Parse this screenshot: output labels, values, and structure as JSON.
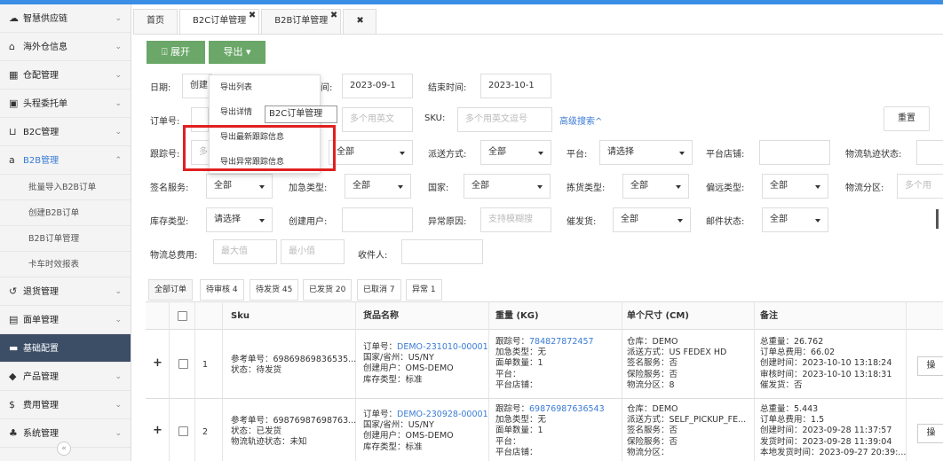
{
  "sidebar": {
    "items": [
      {
        "label": "智慧供应链",
        "icon": "cloud-icon"
      },
      {
        "label": "海外仓信息",
        "icon": "home-icon"
      },
      {
        "label": "仓配管理",
        "icon": "grid-icon"
      },
      {
        "label": "头程委托单",
        "icon": "briefcase-icon"
      },
      {
        "label": "B2C管理",
        "icon": "cart-icon"
      },
      {
        "label": "B2B管理",
        "icon": "amazon-icon"
      }
    ],
    "sub_items": [
      {
        "label": "批量导入B2B订单"
      },
      {
        "label": "创建B2B订单"
      },
      {
        "label": "B2B订单管理"
      },
      {
        "label": "卡车时效报表"
      }
    ],
    "items2": [
      {
        "label": "退货管理",
        "icon": "return-icon"
      },
      {
        "label": "面单管理",
        "icon": "document-icon"
      },
      {
        "label": "基础配置",
        "icon": "folder-icon"
      },
      {
        "label": "产品管理",
        "icon": "tag-icon"
      },
      {
        "label": "费用管理",
        "icon": "dollar-icon"
      },
      {
        "label": "系统管理",
        "icon": "car-icon"
      }
    ]
  },
  "tabs": [
    {
      "label": "首页"
    },
    {
      "label": "B2C订单管理"
    },
    {
      "label": "B2B订单管理"
    }
  ],
  "toolbar": {
    "expand_label": "展开",
    "export_label": "导出"
  },
  "export_menu": [
    {
      "label": "导出列表"
    },
    {
      "label": "导出详情"
    },
    {
      "label": "导出最新跟踪信息"
    },
    {
      "label": "导出异常跟踪信息"
    }
  ],
  "tooltip": "B2C订单管理",
  "filters": {
    "date_label": "日期:",
    "date_type": "创建",
    "date_label2": "间:",
    "start_date": "2023-09-1",
    "end_label": "结束时间:",
    "end_date": "2023-10-1",
    "order_no_label": "订单号:",
    "order_no_placeholder": "多个用英文",
    "sku_label": "SKU:",
    "sku_placeholder": "多个用英文逗号",
    "advanced": "高级搜索^",
    "reset": "重置",
    "tracking_label": "跟踪号:",
    "tracking_prefix": "多",
    "all": "全部",
    "ship_method_label": "派送方式:",
    "platform_label": "平台:",
    "please_select": "请选择",
    "shop_label": "平台店铺:",
    "track_status_label": "物流轨迹状态:",
    "sign_service_label": "签名服务:",
    "urgent_label": "加急类型:",
    "country_label": "国家:",
    "pick_type_label": "拣货类型:",
    "remote_label": "偏远类型:",
    "zone_label": "物流分区:",
    "zone_placeholder": "多个用",
    "stock_type_label": "库存类型:",
    "creator_label": "创建用户:",
    "exception_label": "异常原因:",
    "exception_placeholder": "支持模糊搜",
    "urge_label": "催发货:",
    "mail_status_label": "邮件状态:",
    "fee_label": "物流总费用:",
    "max_placeholder": "最大值",
    "min_placeholder": "最小值",
    "receiver_label": "收件人:"
  },
  "status_tabs": [
    {
      "label": "全部订单"
    },
    {
      "label": "待审核 4"
    },
    {
      "label": "待发货 45"
    },
    {
      "label": "已发货 20"
    },
    {
      "label": "已取消 7"
    },
    {
      "label": "异常 1"
    }
  ],
  "table": {
    "headers": {
      "sku": "Sku",
      "goods": "货品名称",
      "weight": "重量 (KG)",
      "size": "单个尺寸 (CM)",
      "note": "备注"
    },
    "rows": [
      {
        "idx": "1",
        "sku": [
          "参考单号：69869869836535...",
          "状态：待发货"
        ],
        "goods_l": "订单号：",
        "goods_link": "DEMO-231010-00001",
        "goods": [
          "国家/省州：US/NY",
          "创建用户：OMS-DEMO",
          "库存类型：标准"
        ],
        "weight_l": "跟踪号：",
        "weight_link": "784827872457",
        "weight": [
          "加急类型：无",
          "面单数量：1",
          "平台：",
          "平台店铺："
        ],
        "size": [
          "仓库：DEMO",
          "派送方式：US FEDEX HD",
          "签名服务：否",
          "保险服务：否",
          "物流分区：8"
        ],
        "note": [
          "总重量：26.762",
          "订单总费用：66.02",
          "创建时间：2023-10-10 13:18:24",
          "审核时间：2023-10-10 13:18:31",
          "催发货：否"
        ]
      },
      {
        "idx": "2",
        "sku": [
          "参考单号：69876987698763...",
          "状态：已发货",
          "物流轨迹状态：未知"
        ],
        "goods_l": "订单号：",
        "goods_link": "DEMO-230928-00001",
        "goods": [
          "国家/省州：US/NY",
          "创建用户：OMS-DEMO",
          "库存类型：标准"
        ],
        "weight_l": "跟踪号：",
        "weight_link": "69876987636543",
        "weight": [
          "加急类型：无",
          "面单数量：1",
          "平台：",
          "平台店铺："
        ],
        "size": [
          "仓库：DEMO",
          "派送方式：SELF_PICKUP_FE...",
          "签名服务：否",
          "保险服务：否",
          "物流分区："
        ],
        "note": [
          "总重量：5.443",
          "订单总费用：1.5",
          "创建时间：2023-09-28 11:37:57",
          "发货时间：2023-09-28 11:39:04",
          "本地发货时间：2023-09-27 20:39:..."
        ]
      }
    ],
    "action_label": "操"
  },
  "colors": {
    "accent": "#3a7bd5",
    "green": "#6aa768",
    "highlight": "#e02020",
    "sidebar_dark": "#3c4d66"
  }
}
